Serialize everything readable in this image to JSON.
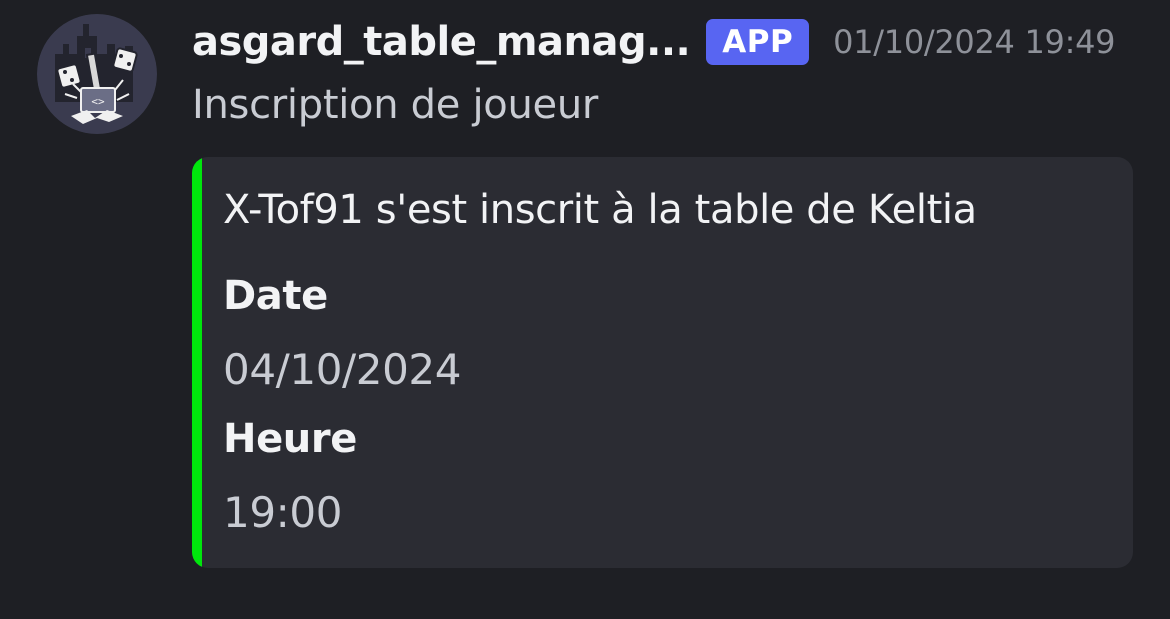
{
  "message": {
    "author": {
      "username": "asgard_table_manag...",
      "badge": "APP",
      "avatar_icon": "castle-dice-hammer-logo"
    },
    "timestamp": "01/10/2024 19:49",
    "content": "Inscription de joueur",
    "embed": {
      "accent_color": "#00e60c",
      "title": "X-Tof91 s'est inscrit à la table de Keltia",
      "fields": [
        {
          "name": "Date",
          "value": "04/10/2024"
        },
        {
          "name": "Heure",
          "value": "19:00"
        }
      ]
    }
  },
  "colors": {
    "background": "#1e1f24",
    "embed_background": "#2b2c33",
    "badge": "#5865f2",
    "text_primary": "#f2f3f5",
    "text_muted": "#8e9199"
  }
}
